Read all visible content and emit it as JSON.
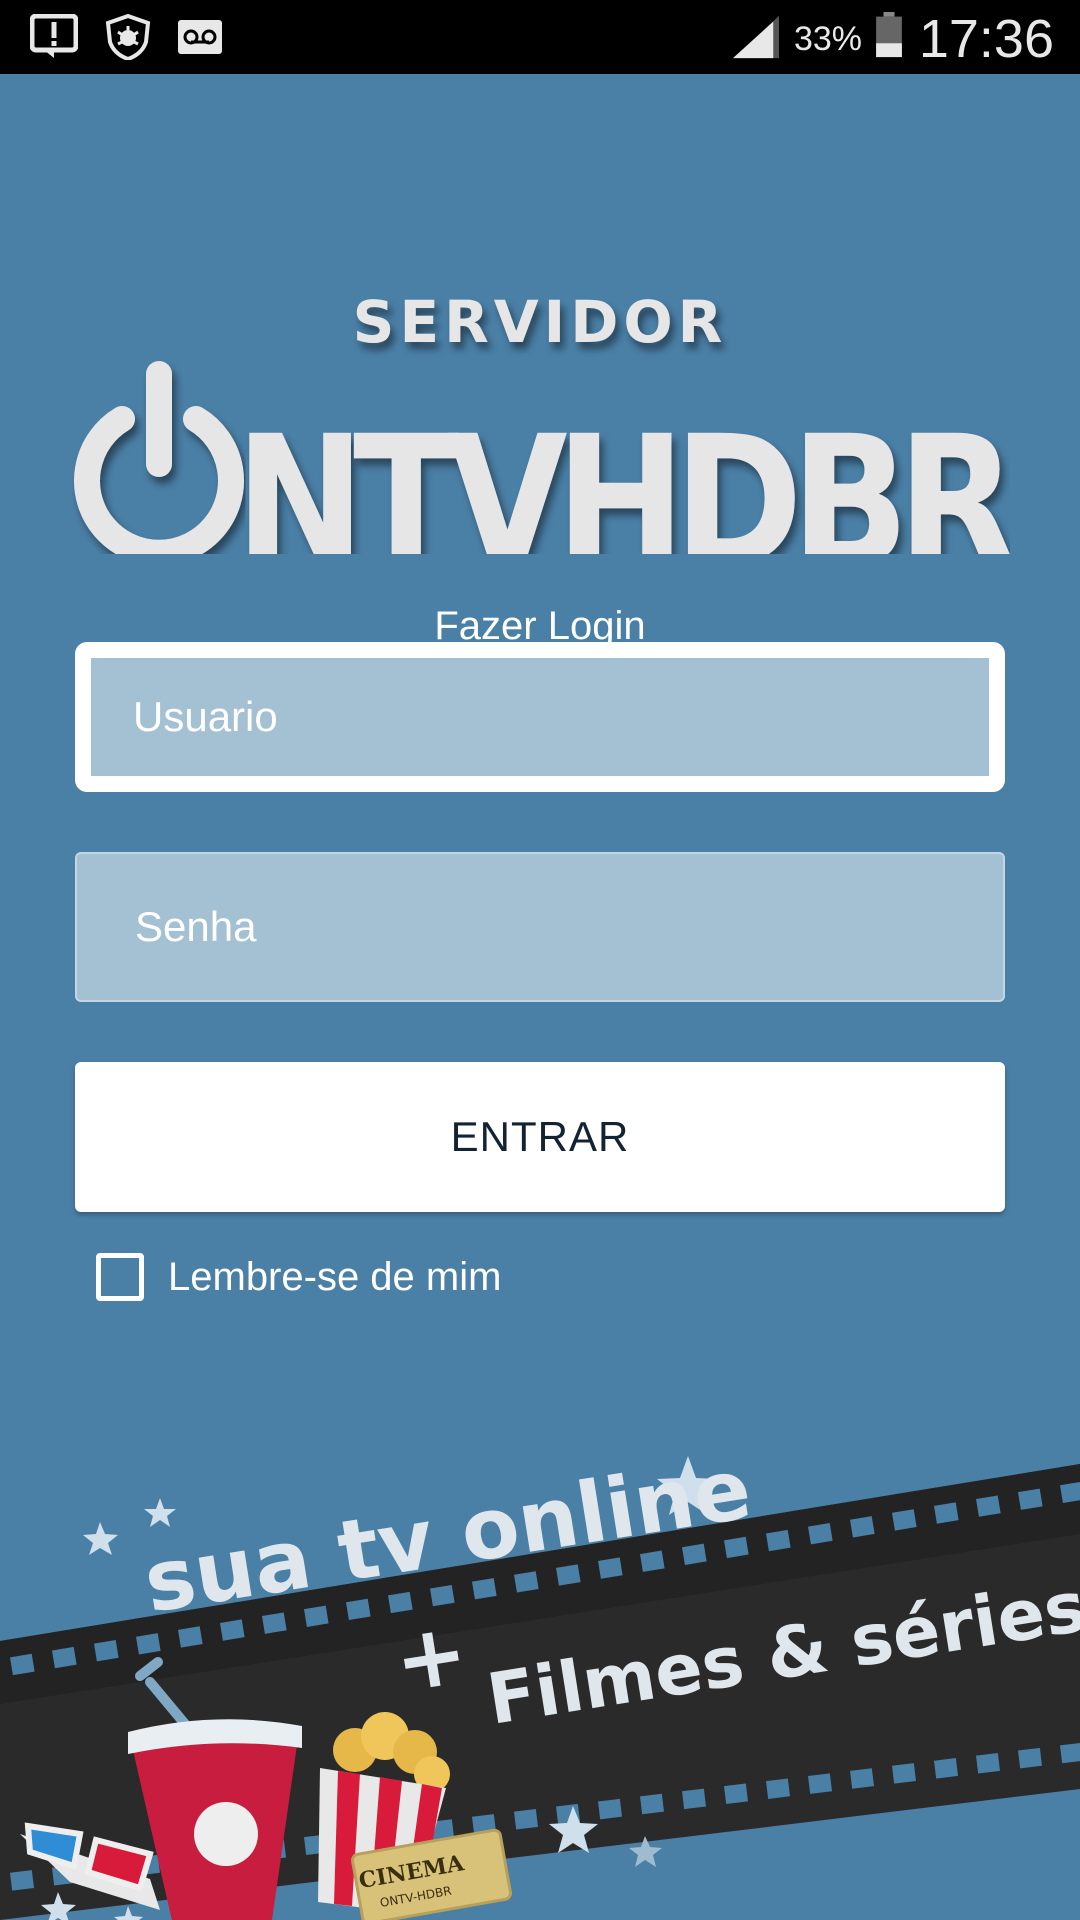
{
  "status_bar": {
    "icons": [
      "alert-icon",
      "shield-icon",
      "voicemail-icon",
      "signal-icon",
      "battery-icon"
    ],
    "battery_percent": "33%",
    "time": "17:36"
  },
  "logo": {
    "top_text": "SERVIDOR",
    "brand_text": "ONTVHDBR",
    "icon": "power-icon"
  },
  "login": {
    "title": "Fazer Login",
    "username_placeholder": "Usuario",
    "password_placeholder": "Senha",
    "submit_label": "ENTRAR",
    "remember_label": "Lembre-se de mim",
    "remember_checked": false
  },
  "banner": {
    "line1": "sua tv online",
    "plus": "+",
    "line2": "Filmes & séries",
    "ticket_text": "CINEMA",
    "ticket_subtext": "ONTV-HDBR"
  },
  "colors": {
    "background": "#4a7fa6",
    "field_fill": "#a4c0d3",
    "button_text": "#142331",
    "film_strip": "#2a2a2a"
  }
}
